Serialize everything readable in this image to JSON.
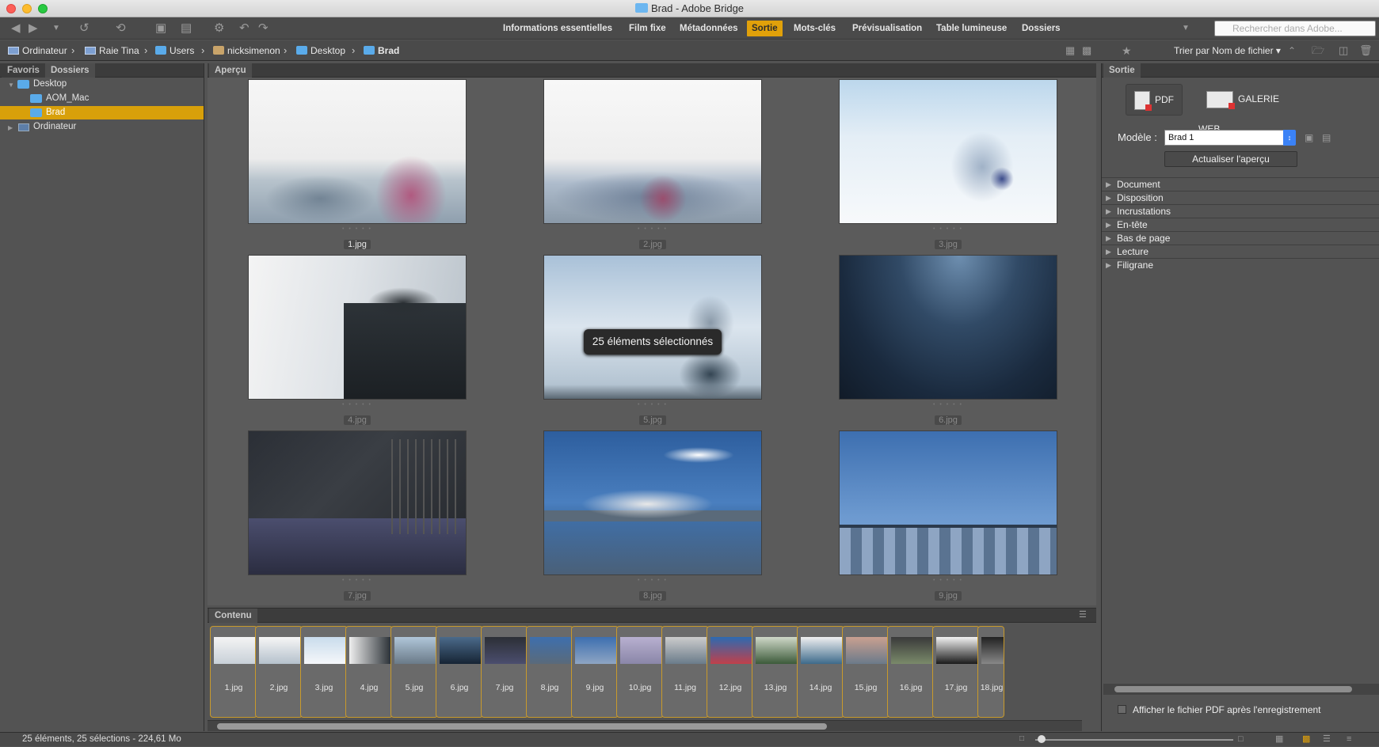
{
  "window": {
    "title": "Brad - Adobe Bridge"
  },
  "workspaces": [
    {
      "label": "Informations essentielles",
      "active": false
    },
    {
      "label": "Film fixe",
      "active": false
    },
    {
      "label": "Métadonnées",
      "active": false
    },
    {
      "label": "Sortie",
      "active": true
    },
    {
      "label": "Mots-clés",
      "active": false
    },
    {
      "label": "Prévisualisation",
      "active": false
    },
    {
      "label": "Table lumineuse",
      "active": false
    },
    {
      "label": "Dossiers",
      "active": false
    }
  ],
  "search": {
    "placeholder": "Rechercher dans Adobe..."
  },
  "breadcrumb": [
    "Ordinateur",
    "Raie Tina",
    "Users",
    "nicksimenon",
    "Desktop",
    "Brad"
  ],
  "sort": {
    "label": "Trier par Nom de fichier"
  },
  "left_panel": {
    "tabs": [
      "Favoris",
      "Dossiers"
    ],
    "tree": [
      {
        "label": "Desktop",
        "level": 0,
        "expanded": true,
        "selected": false
      },
      {
        "label": "AOM_Mac",
        "level": 1,
        "selected": false
      },
      {
        "label": "Brad",
        "level": 1,
        "selected": true
      },
      {
        "label": "Ordinateur",
        "level": 0,
        "expanded": false,
        "selected": false
      }
    ]
  },
  "preview": {
    "tab": "Aperçu",
    "tooltip": "25 éléments sélectionnés",
    "thumbnails": [
      "1.jpg",
      "2.jpg",
      "3.jpg",
      "4.jpg",
      "5.jpg",
      "6.jpg",
      "7.jpg",
      "8.jpg",
      "9.jpg"
    ]
  },
  "content": {
    "tab": "Contenu",
    "items": [
      "1.jpg",
      "2.jpg",
      "3.jpg",
      "4.jpg",
      "5.jpg",
      "6.jpg",
      "7.jpg",
      "8.jpg",
      "9.jpg",
      "10.jpg",
      "11.jpg",
      "12.jpg",
      "13.jpg",
      "14.jpg",
      "15.jpg",
      "16.jpg",
      "17.jpg",
      "18.jpg"
    ]
  },
  "output": {
    "tab": "Sortie",
    "pdf_label": "PDF",
    "web_label": "GALERIE WEB",
    "model_label": "Modèle :",
    "model_value": "Brad 1",
    "refresh_label": "Actualiser l'aperçu",
    "sections": [
      "Document",
      "Disposition",
      "Incrustations",
      "En-tête",
      "Bas de page",
      "Lecture",
      "Filigrane"
    ],
    "checkbox_label": "Afficher le fichier PDF après l'enregistrement"
  },
  "status": {
    "text": "25 éléments, 25 sélections - 224,61 Mo"
  },
  "colors": {
    "accent": "#e1a10a",
    "panel": "#535353"
  }
}
